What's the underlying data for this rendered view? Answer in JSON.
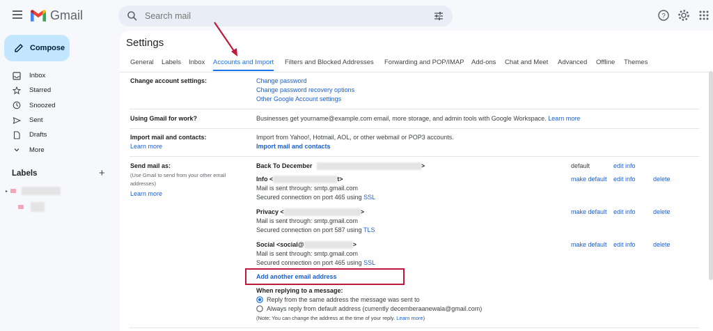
{
  "header": {
    "app_name": "Gmail",
    "search_placeholder": "Search mail"
  },
  "sidebar": {
    "compose_label": "Compose",
    "items": [
      {
        "label": "Inbox",
        "icon": "inbox-icon"
      },
      {
        "label": "Starred",
        "icon": "star-icon"
      },
      {
        "label": "Snoozed",
        "icon": "clock-icon"
      },
      {
        "label": "Sent",
        "icon": "send-icon"
      },
      {
        "label": "Drafts",
        "icon": "draft-icon"
      },
      {
        "label": "More",
        "icon": "chevron-down-icon"
      }
    ],
    "labels_heading": "Labels",
    "labels_add": "+"
  },
  "settings": {
    "title": "Settings",
    "tabs": [
      "General",
      "Labels",
      "Inbox",
      "Accounts and Import",
      "Filters and Blocked Addresses",
      "Forwarding and POP/IMAP",
      "Add-ons",
      "Chat and Meet",
      "Advanced",
      "Offline",
      "Themes"
    ],
    "change_account": {
      "label": "Change account settings:",
      "links": [
        "Change password",
        "Change password recovery options",
        "Other Google Account settings"
      ]
    },
    "work": {
      "label": "Using Gmail for work?",
      "text": "Businesses get yourname@example.com email, more storage, and admin tools with Google Workspace.",
      "link": "Learn more"
    },
    "import": {
      "label": "Import mail and contacts:",
      "learn_more": "Learn more",
      "text": "Import from Yahoo!, Hotmail, AOL, or other webmail or POP3 accounts.",
      "action": "Import mail and contacts"
    },
    "send_as": {
      "label": "Send mail as:",
      "sub_lines": [
        "(Use Gmail to send from your other email",
        "addresses)"
      ],
      "learn_more": "Learn more",
      "accounts": [
        {
          "name": "Back To December",
          "suffix": ">",
          "detail1": "",
          "detail2": "",
          "default_text": "default",
          "edit": "edit info"
        },
        {
          "name": "Info <",
          "suffix": "t>",
          "detail1": "Mail is sent through: smtp.gmail.com",
          "detail2_pre": "Secured connection on port 465 using ",
          "detail2_link": "SSL",
          "make_default": "make default",
          "edit": "edit info",
          "delete": "delete"
        },
        {
          "name": "Privacy <",
          "suffix": ">",
          "detail1": "Mail is sent through: smtp.gmail.com",
          "detail2_pre": "Secured connection on port 587 using ",
          "detail2_link": "TLS",
          "make_default": "make default",
          "edit": "edit info",
          "delete": "delete"
        },
        {
          "name": "Social <social@",
          "suffix": ">",
          "detail1": "Mail is sent through: smtp.gmail.com",
          "detail2_pre": "Secured connection on port 465 using ",
          "detail2_link": "SSL",
          "make_default": "make default",
          "edit": "edit info",
          "delete": "delete"
        }
      ],
      "add_another": "Add another email address",
      "reply_heading": "When replying to a message:",
      "reply_options": [
        {
          "label": "Reply from the same address the message was sent to",
          "checked": true
        },
        {
          "label": "Always reply from default address (currently decemberaanewala@gmail.com)",
          "checked": false
        }
      ],
      "note_text": "(Note: You can change the address at the time of your reply.",
      "note_link": "Learn more",
      "note_end": ")"
    }
  },
  "colors": {
    "accent": "#1a73e8",
    "annotation": "#c0183a",
    "compose_bg": "#c2e7ff"
  }
}
